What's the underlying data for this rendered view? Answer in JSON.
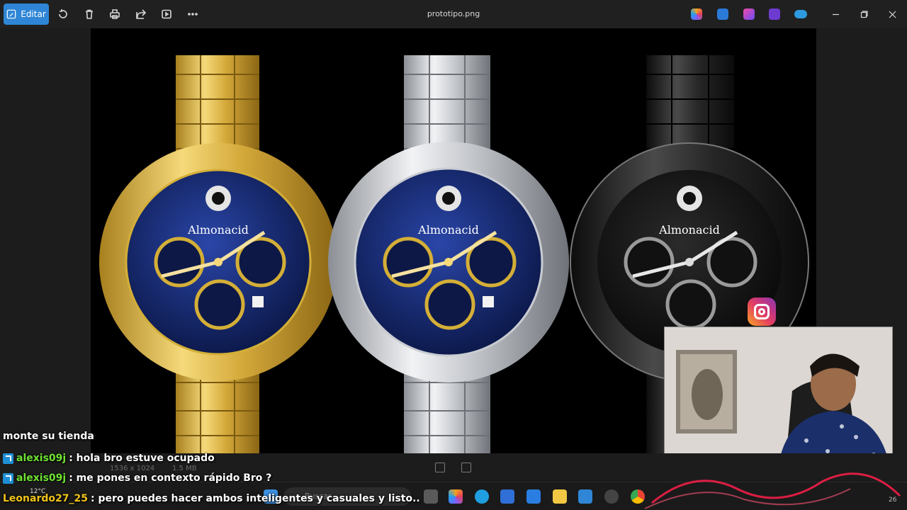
{
  "window": {
    "title": "prototipo.png",
    "edit_label": "Editar"
  },
  "toolbar": {
    "icons": [
      "rotate-icon",
      "delete-icon",
      "print-icon",
      "share-icon",
      "slideshow-icon",
      "more-icon"
    ]
  },
  "photo": {
    "brand": [
      "Almonacid",
      "Almonacid",
      "Almonacid"
    ],
    "watches": [
      {
        "finish": "gold",
        "dial": "#0f1f5c",
        "metal": "#d4af37"
      },
      {
        "finish": "silver",
        "dial": "#0f1f5c",
        "metal": "#c9ccd1"
      },
      {
        "finish": "black",
        "dial": "#0b0b0b",
        "metal": "#2a2a2a"
      }
    ]
  },
  "status": {
    "dimensions": "1536 x 1024",
    "size": "1.5 MB"
  },
  "chat": [
    {
      "user": "",
      "message": "monte su tienda",
      "color": "white",
      "badge": false
    },
    {
      "user": "alexis09j",
      "message": ": hola bro estuve ocupado",
      "color": "green",
      "badge": true
    },
    {
      "user": "alexis09j",
      "message": ": me pones en contexto rápido Bro ?",
      "color": "green",
      "badge": true
    },
    {
      "user": "Leonardo27_25",
      "message": ": pero puedes hacer ambos inteligentes y casuales y listo..",
      "color": "yellow",
      "badge": false
    }
  ],
  "taskbar": {
    "search_placeholder": "Buscar",
    "weather": "12°C",
    "clock_fragment": "26"
  },
  "colors": {
    "accent": "#2f86d6",
    "titlebar": "#202020",
    "background": "#1c1c1c",
    "chat_green": "#6fe233",
    "chat_yellow": "#f0c419"
  }
}
